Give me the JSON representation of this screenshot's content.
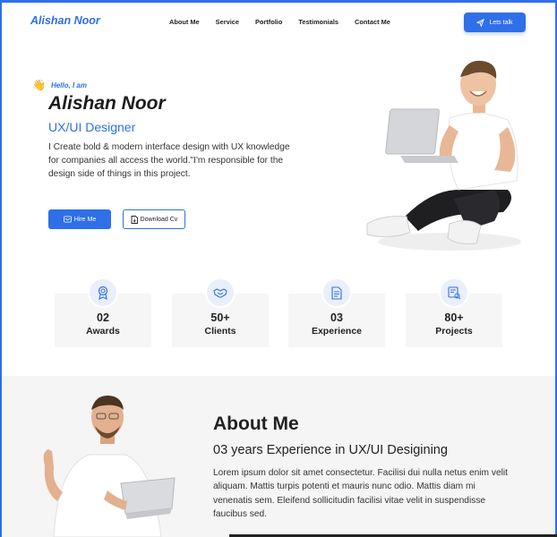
{
  "header": {
    "logo": "Alishan Noor",
    "nav": [
      "About Me",
      "Service",
      "Portfolio",
      "Testimonials",
      "Contact Me"
    ],
    "cta_label": "Lets talk"
  },
  "hero": {
    "greeting": "Hello, I am",
    "name": "Alishan Noor",
    "role": "UX/UI Designer",
    "description": "I Create bold & modern interface design with UX knowledge for companies all access the world.\"I'm responsible for the design side of things in this project.",
    "hire_label": "Hire Me",
    "download_label": "Download Cv"
  },
  "stats": [
    {
      "value": "02",
      "label": "Awards",
      "icon": "award-icon"
    },
    {
      "value": "50+",
      "label": "Clients",
      "icon": "handshake-icon"
    },
    {
      "value": "03",
      "label": "Experience",
      "icon": "document-icon"
    },
    {
      "value": "80+",
      "label": "Projects",
      "icon": "project-icon"
    }
  ],
  "about": {
    "title": "About Me",
    "subtitle": "03 years Experience in UX/UI Desigining",
    "description": "Lorem ipsum dolor sit amet consectetur. Facilisi dui nulla netus enim velit aliquam. Mattis turpis potenti et mauris nunc odio. Mattis diam mi venenatis sem. Eleifend sollicitudin facilisi vitae velit in suspendisse faucibus sed."
  },
  "colors": {
    "accent": "#2f6fe8",
    "text": "#222222",
    "card_bg": "#f6f6f7",
    "section_bg": "#f5f5f5"
  }
}
